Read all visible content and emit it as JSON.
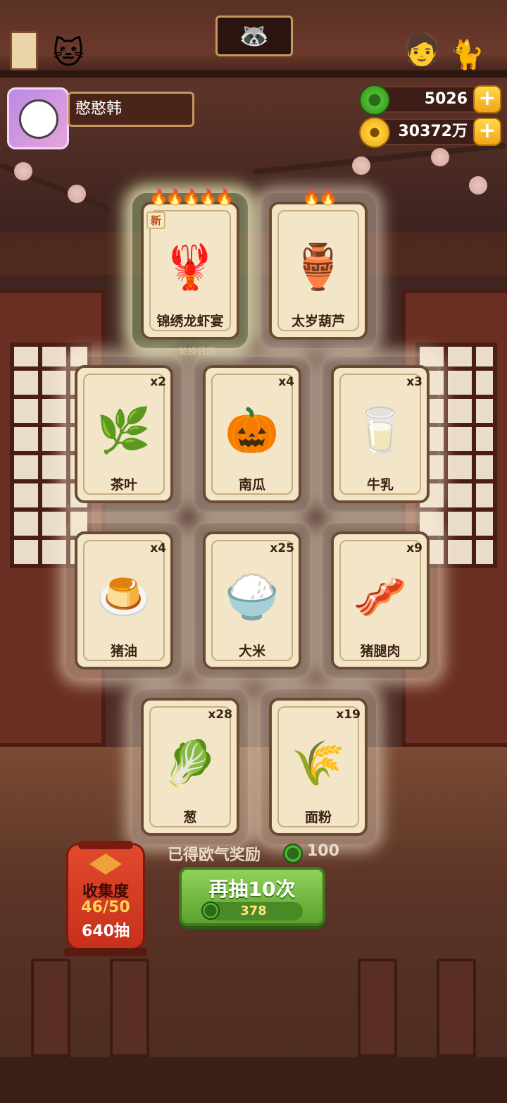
{
  "player": {
    "name": "憨憨韩"
  },
  "currency": {
    "jade": {
      "value": "5026",
      "icon": "jade-icon",
      "plus": "+"
    },
    "coin": {
      "value": "30372万",
      "icon": "coin-icon",
      "plus": "+"
    }
  },
  "featured_cards": [
    {
      "name": "锦绣龙虾宴",
      "flames": 5,
      "new_tag": "新",
      "art": "🦞"
    },
    {
      "name": "太岁葫芦",
      "flames": 2,
      "art": "🏺"
    }
  ],
  "calendar_hint": "轮换日历",
  "cards": [
    {
      "name": "茶叶",
      "count": "x2",
      "art": "🌿"
    },
    {
      "name": "南瓜",
      "count": "x4",
      "art": "🎃"
    },
    {
      "name": "牛乳",
      "count": "x3",
      "art": "🥛"
    },
    {
      "name": "猪油",
      "count": "x4",
      "art": "🍮"
    },
    {
      "name": "大米",
      "count": "x25",
      "art": "🍚"
    },
    {
      "name": "猪腿肉",
      "count": "x9",
      "art": "🥓"
    },
    {
      "name": "葱",
      "count": "x28",
      "art": "🥬"
    },
    {
      "name": "面粉",
      "count": "x19",
      "art": "🌾"
    }
  ],
  "reward": {
    "label": "已得欧气奖励",
    "value": "100"
  },
  "collection": {
    "title": "收集度",
    "progress": "46/50",
    "draws": "640抽",
    "progress_fraction": 0.92
  },
  "draw_button": {
    "label": "再抽10次",
    "cost": "378"
  }
}
